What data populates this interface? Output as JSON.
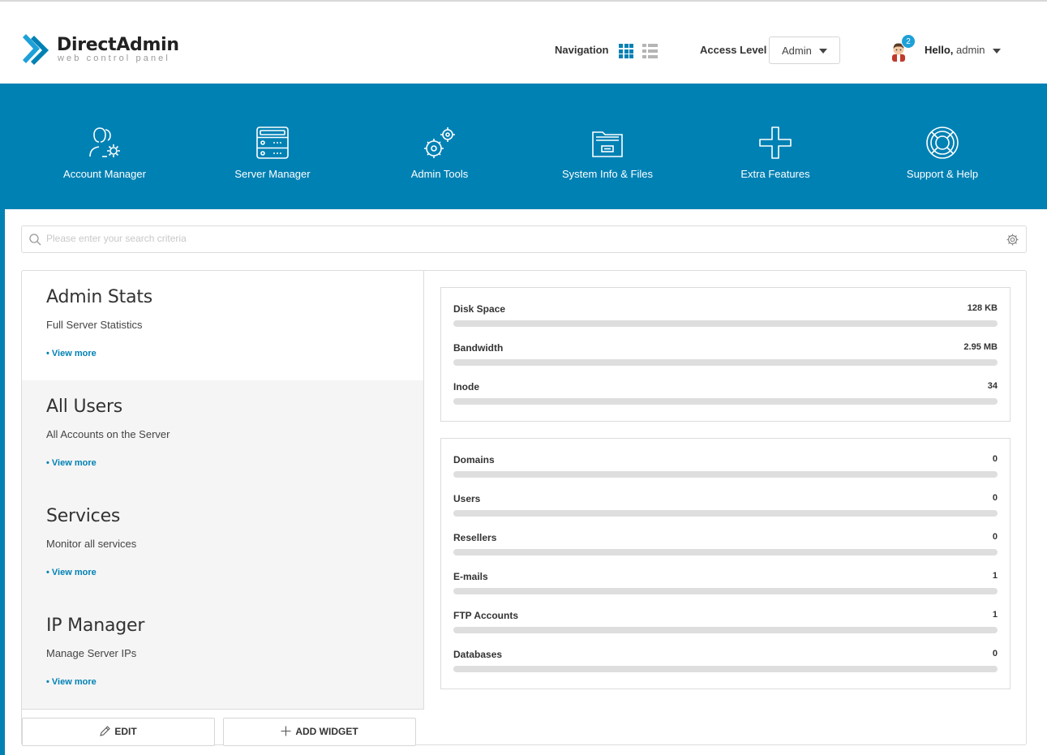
{
  "logo": {
    "name": "DirectAdmin",
    "tagline": "web control panel"
  },
  "header": {
    "navigation_label": "Navigation",
    "access_level_label": "Access Level",
    "access_level_value": "Admin",
    "notification_count": "2",
    "hello_prefix": "Hello,",
    "username": "admin"
  },
  "nav_items": [
    {
      "label": "Account Manager",
      "icon": "account-manager-icon"
    },
    {
      "label": "Server Manager",
      "icon": "server-manager-icon"
    },
    {
      "label": "Admin Tools",
      "icon": "admin-tools-icon"
    },
    {
      "label": "System Info & Files",
      "icon": "system-info-icon"
    },
    {
      "label": "Extra Features",
      "icon": "extra-features-icon"
    },
    {
      "label": "Support & Help",
      "icon": "support-help-icon"
    }
  ],
  "search": {
    "placeholder": "Please enter your search criteria"
  },
  "widgets": [
    {
      "title": "Admin Stats",
      "subtitle": "Full Server Statistics",
      "link": "• View more"
    },
    {
      "title": "All Users",
      "subtitle": "All Accounts on the Server",
      "link": "• View more"
    },
    {
      "title": "Services",
      "subtitle": "Monitor all services",
      "link": "• View more"
    },
    {
      "title": "IP Manager",
      "subtitle": "Manage Server IPs",
      "link": "• View more"
    }
  ],
  "buttons": {
    "edit": "EDIT",
    "add_widget": "ADD WIDGET"
  },
  "usage_stats": [
    {
      "label": "Disk Space",
      "value": "128 KB",
      "fill": 0
    },
    {
      "label": "Bandwidth",
      "value": "2.95 MB",
      "fill": 0
    },
    {
      "label": "Inode",
      "value": "34",
      "fill": 0
    }
  ],
  "count_stats": [
    {
      "label": "Domains",
      "value": "0",
      "fill": 0
    },
    {
      "label": "Users",
      "value": "0",
      "fill": 0
    },
    {
      "label": "Resellers",
      "value": "0",
      "fill": 0
    },
    {
      "label": "E-mails",
      "value": "1",
      "fill": 0
    },
    {
      "label": "FTP Accounts",
      "value": "1",
      "fill": 0
    },
    {
      "label": "Databases",
      "value": "0",
      "fill": 0
    }
  ],
  "colors": {
    "brand_blue": "#0081b4",
    "badge_blue": "#1ea0d8",
    "bar_track": "#dedede"
  }
}
